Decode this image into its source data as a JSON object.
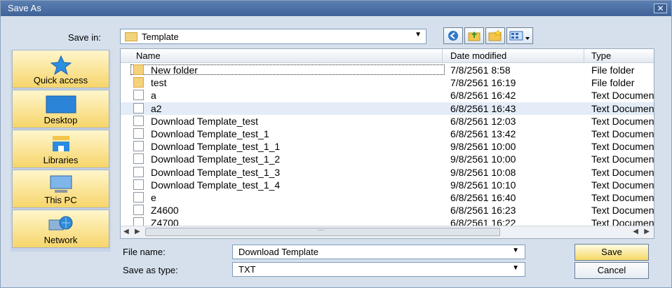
{
  "window": {
    "title": "Save As"
  },
  "toolbar": {
    "save_in_label": "Save in:",
    "save_in_value": "Template"
  },
  "places": [
    {
      "label": "Quick access",
      "icon": "star-icon"
    },
    {
      "label": "Desktop",
      "icon": "desktop-icon"
    },
    {
      "label": "Libraries",
      "icon": "libraries-icon"
    },
    {
      "label": "This PC",
      "icon": "computer-icon"
    },
    {
      "label": "Network",
      "icon": "network-icon"
    }
  ],
  "columns": {
    "name": "Name",
    "date": "Date modified",
    "type": "Type"
  },
  "files": [
    {
      "name": "New folder",
      "date": "7/8/2561 8:58",
      "type": "File folder",
      "kind": "folder"
    },
    {
      "name": "test",
      "date": "7/8/2561 16:19",
      "type": "File folder",
      "kind": "folder"
    },
    {
      "name": "a",
      "date": "6/8/2561 16:42",
      "type": "Text Document",
      "kind": "doc"
    },
    {
      "name": "a2",
      "date": "6/8/2561 16:43",
      "type": "Text Document",
      "kind": "doc"
    },
    {
      "name": "Download Template_test",
      "date": "6/8/2561 12:03",
      "type": "Text Document",
      "kind": "doc"
    },
    {
      "name": "Download Template_test_1",
      "date": "6/8/2561 13:42",
      "type": "Text Document",
      "kind": "doc"
    },
    {
      "name": "Download Template_test_1_1",
      "date": "9/8/2561 10:00",
      "type": "Text Document",
      "kind": "doc"
    },
    {
      "name": "Download Template_test_1_2",
      "date": "9/8/2561 10:00",
      "type": "Text Document",
      "kind": "doc"
    },
    {
      "name": "Download Template_test_1_3",
      "date": "9/8/2561 10:08",
      "type": "Text Document",
      "kind": "doc"
    },
    {
      "name": "Download Template_test_1_4",
      "date": "9/8/2561 10:10",
      "type": "Text Document",
      "kind": "doc"
    },
    {
      "name": "e",
      "date": "6/8/2561 16:40",
      "type": "Text Document",
      "kind": "doc"
    },
    {
      "name": "Z4600",
      "date": "6/8/2561 16:23",
      "type": "Text Document",
      "kind": "doc"
    },
    {
      "name": "Z4700",
      "date": "6/8/2561 16:22",
      "type": "Text Document",
      "kind": "doc"
    }
  ],
  "form": {
    "file_name_label": "File name:",
    "file_name_value": "Download Template",
    "save_type_label": "Save as type:",
    "save_type_value": "TXT"
  },
  "buttons": {
    "save": "Save",
    "cancel": "Cancel"
  },
  "colors": {
    "titlebar": "#4a6fa5",
    "accent_button": "#f6d964",
    "selected_row": "#e3ecf7"
  }
}
